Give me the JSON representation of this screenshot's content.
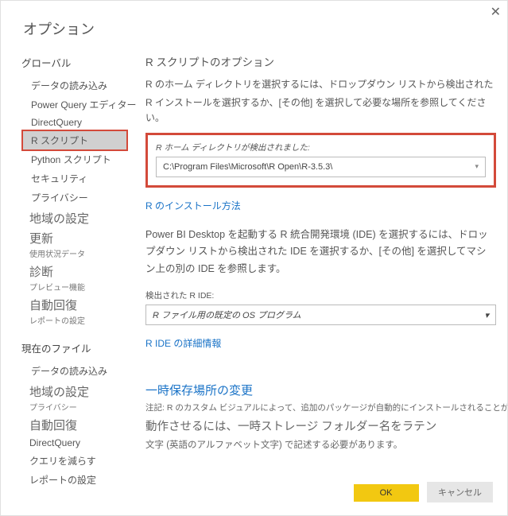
{
  "window": {
    "title": "オプション"
  },
  "sidebar": {
    "g1": {
      "header": "グローバル",
      "items": [
        "データの読み込み",
        "Power Query エディター",
        "DirectQuery",
        "R スクリプト",
        "Python スクリプト",
        "セキュリティ",
        "プライバシー"
      ],
      "big": [
        {
          "l1": "地域の設定"
        },
        {
          "l1": "更新",
          "l2": "使用状況データ"
        },
        {
          "l1": "診断",
          "l2": "プレビュー機能"
        },
        {
          "l1": "自動回復",
          "l2": "レポートの設定"
        }
      ]
    },
    "g2": {
      "header": "現在のファイル",
      "items": [
        "データの読み込み"
      ],
      "big": [
        {
          "l1": "地域の設定",
          "l2": "プライバシー"
        },
        {
          "l1": "自動回復"
        }
      ],
      "tail": [
        "DirectQuery",
        "クエリを減らす",
        "レポートの設定"
      ]
    }
  },
  "content": {
    "section": "R スクリプトのオプション",
    "desc1": "R のホーム ディレクトリを選択するには、ドロップダウン リストから検出された",
    "desc2": "R インストールを選択するか、[その他] を選択して必要な場所を参照してください。",
    "rbox_label": "R ホーム ディレクトリが検出されました:",
    "rbox_value": "C:\\Program Files\\Microsoft\\R Open\\R-3.5.3\\",
    "install_link": "R のインストール方法",
    "ide_desc": "Power BI Desktop を起動する R 統合開発環境 (IDE) を選択するには、ドロップダウン リストから検出された IDE を選択するか、[その他] を選択してマシン上の別の IDE を参照します。",
    "ide_label": "検出された R IDE:",
    "ide_value": "R ファイル用の既定の OS プログラム",
    "ide_link": "R IDE の詳細情報",
    "temp_header": "一時保存場所の変更",
    "temp_note": "注記: R のカスタム ビジュアルによって、追加のパッケージが自動的にインストールされることがあります",
    "temp_desc": "動作させるには、一時ストレージ フォルダー名をラテン",
    "temp_desc2": "文字 (英語のアルファベット文字) で記述する必要があります。"
  },
  "footer": {
    "ok": "OK",
    "cancel": "キャンセル"
  }
}
